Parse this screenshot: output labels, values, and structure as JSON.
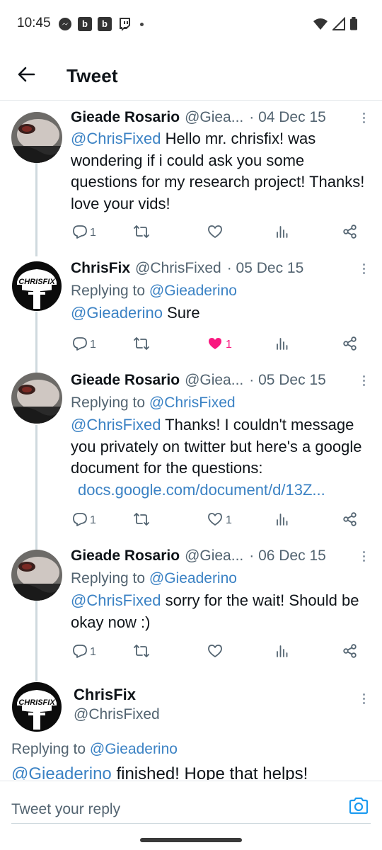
{
  "status_bar": {
    "time": "10:45",
    "left_icons": [
      "messenger-icon",
      "b-app-icon",
      "b-app-icon",
      "twitch-icon",
      "dot"
    ],
    "b_label": "b",
    "right_icons": [
      "wifi-icon",
      "signal-icon",
      "battery-icon"
    ]
  },
  "header": {
    "title": "Tweet"
  },
  "colors": {
    "link": "#3b82c4",
    "like": "#f91880",
    "secondary": "#536471",
    "thread_line": "#cfd9de"
  },
  "tweets": [
    {
      "name": "Gieade Rosario",
      "handle": "@Giea...",
      "date": "· 04 Dec 15",
      "replying_to": null,
      "mention": "@ChrisFixed",
      "text": " Hello mr. chrisfix! was wondering if i could ask you some questions for my research project! Thanks! love your vids!",
      "url": null,
      "reply_count": "1",
      "like_count": "",
      "liked": false
    },
    {
      "name": "ChrisFix",
      "handle": "@ChrisFixed",
      "date": "· 05 Dec 15",
      "replying_to_prefix": "Replying to ",
      "replying_to": "@Gieaderino",
      "mention": "@Gieaderino",
      "text": " Sure",
      "url": null,
      "reply_count": "1",
      "like_count": "1",
      "liked": true
    },
    {
      "name": "Gieade Rosario",
      "handle": "@Giea...",
      "date": "· 05 Dec 15",
      "replying_to_prefix": "Replying to ",
      "replying_to": "@ChrisFixed",
      "mention": "@ChrisFixed",
      "text": " Thanks! I couldn't message you privately on twitter but here's a google document for the questions:",
      "url": "docs.google.com/document/d/13Z...",
      "reply_count": "1",
      "like_count": "1",
      "liked": false
    },
    {
      "name": "Gieade Rosario",
      "handle": "@Giea...",
      "date": "· 06 Dec 15",
      "replying_to_prefix": "Replying to ",
      "replying_to": "@Gieaderino",
      "mention": "@ChrisFixed",
      "text": " sorry for the wait! Should be okay now :)",
      "url": null,
      "reply_count": "1",
      "like_count": "",
      "liked": false
    }
  ],
  "focused_tweet": {
    "name": "ChrisFix",
    "handle": "@ChrisFixed",
    "replying_to_prefix": "Replying to ",
    "replying_to": "@Gieaderino",
    "mention": "@Gieaderino",
    "text": " finished! Hope that helps!"
  },
  "reply_box": {
    "placeholder": "Tweet your reply"
  }
}
